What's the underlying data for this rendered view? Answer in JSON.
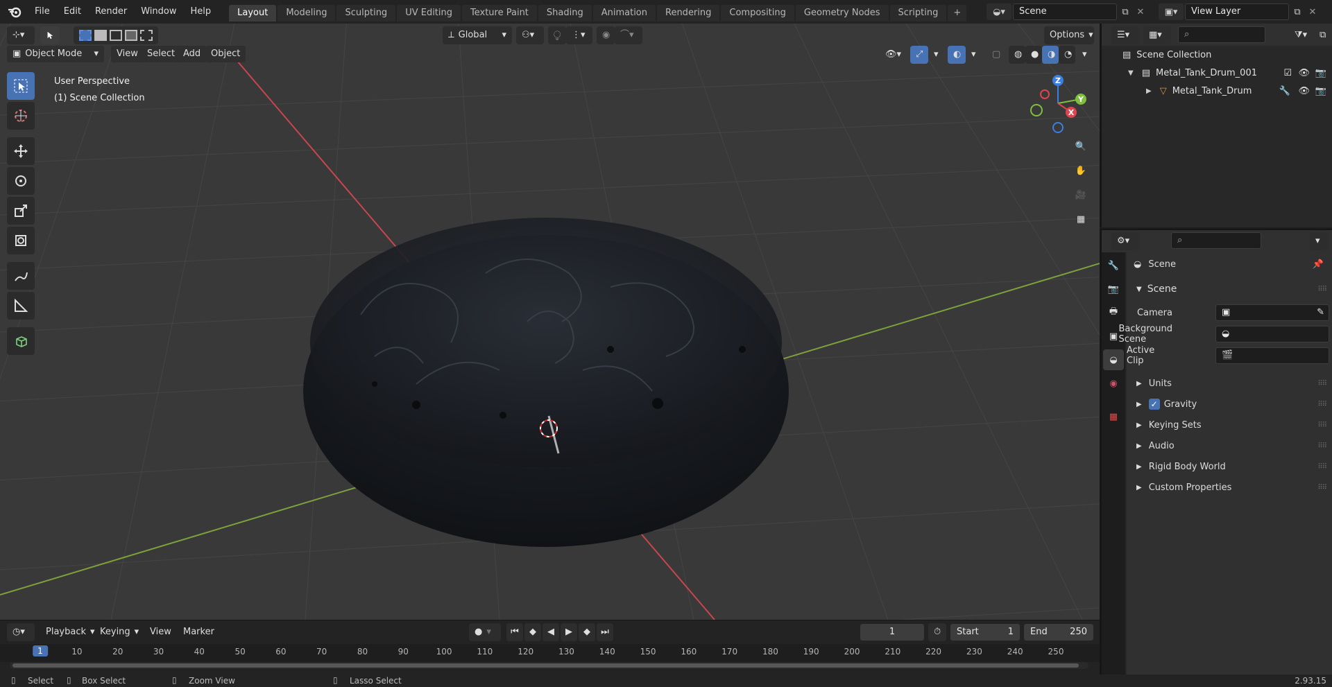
{
  "menubar": {
    "items": [
      "File",
      "Edit",
      "Render",
      "Window",
      "Help"
    ],
    "workspaces": [
      "Layout",
      "Modeling",
      "Sculpting",
      "UV Editing",
      "Texture Paint",
      "Shading",
      "Animation",
      "Rendering",
      "Compositing",
      "Geometry Nodes",
      "Scripting"
    ],
    "active_workspace": "Layout",
    "scene": "Scene",
    "view_layer": "View Layer"
  },
  "viewport": {
    "transform_orientation": "Global",
    "options_label": "Options",
    "mode": "Object Mode",
    "menu": [
      "View",
      "Select",
      "Add",
      "Object"
    ],
    "overlay_line1": "User Perspective",
    "overlay_line2": "(1) Scene Collection",
    "gizmo_axes": {
      "x": "X",
      "y": "Y",
      "z": "Z"
    },
    "colors": {
      "background": "#393939",
      "x_axis": "#c8474f",
      "y_axis": "#7da13c",
      "object": "#1e2128"
    }
  },
  "outliner": {
    "root": "Scene Collection",
    "items": [
      {
        "name": "Metal_Tank_Drum_001",
        "kind": "collection"
      },
      {
        "name": "Metal_Tank_Drum",
        "kind": "mesh"
      }
    ]
  },
  "properties": {
    "context": "Scene",
    "panel_title": "Scene",
    "fields": {
      "camera": "Camera",
      "background_scene": "Background Scene",
      "active_clip": "Active Clip"
    },
    "sections": [
      "Units",
      "Gravity",
      "Keying Sets",
      "Audio",
      "Rigid Body World",
      "Custom Properties"
    ],
    "gravity_checked": true
  },
  "timeline": {
    "menu": [
      "Playback",
      "Keying",
      "View",
      "Marker"
    ],
    "current_frame": "1",
    "start_label": "Start",
    "start": "1",
    "end_label": "End",
    "end": "250",
    "ruler": [
      "1",
      "10",
      "20",
      "30",
      "40",
      "50",
      "60",
      "70",
      "80",
      "90",
      "100",
      "110",
      "120",
      "130",
      "140",
      "150",
      "160",
      "170",
      "180",
      "190",
      "200",
      "210",
      "220",
      "230",
      "240",
      "250"
    ]
  },
  "statusbar": {
    "select": "Select",
    "box_select": "Box Select",
    "zoom_view": "Zoom View",
    "lasso_select": "Lasso Select",
    "version": "2.93.15"
  },
  "accent": "#4772b3"
}
